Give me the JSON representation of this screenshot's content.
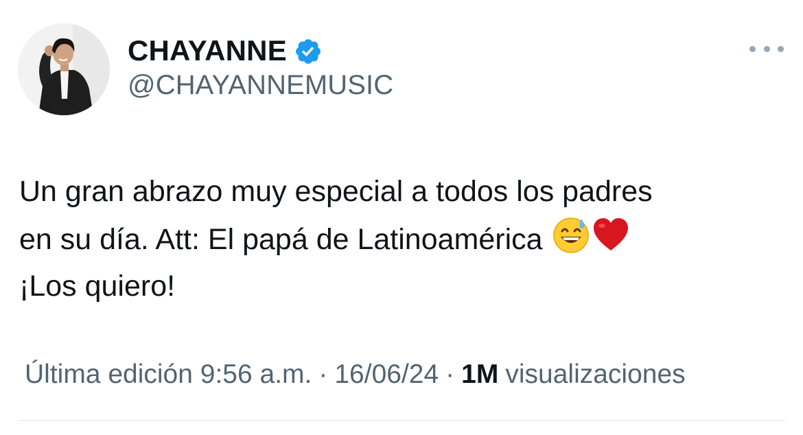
{
  "author": {
    "display_name": "CHAYANNE",
    "handle": "@CHAYANNEMUSIC",
    "verified_icon": "verified-badge-icon",
    "verified_color": "#1d9bf0"
  },
  "tweet": {
    "line1": "Un gran abrazo muy especial a todos los padres",
    "line2": "en su día. Att: El papá de Latinoamérica",
    "line3": "¡Los quiero!",
    "emojis": [
      "grinning-sweat-emoji",
      "red-heart-emoji"
    ]
  },
  "meta": {
    "edited_label": "Última edición 9:56 a.m.",
    "sep1": "·",
    "date": "16/06/24",
    "sep2": "·",
    "views_count": "1M",
    "views_label": "visualizaciones"
  },
  "colors": {
    "text_primary": "#0f1419",
    "text_secondary": "#536471",
    "divider": "#eff3f4"
  }
}
